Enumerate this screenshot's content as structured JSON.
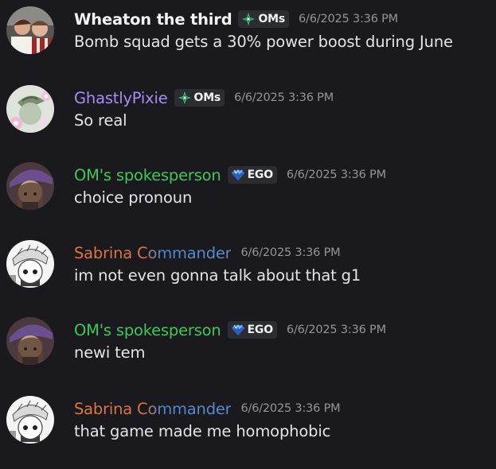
{
  "messages": [
    {
      "username": "Wheaton the third",
      "username_color": "#f3f3f5",
      "tag": "OMs",
      "tag_icon": "green-diamond-sparkle-icon",
      "timestamp": "6/6/2025 3:36 PM",
      "content": "Bomb squad gets a 30% power boost during June",
      "avatar": "photo-avatar"
    },
    {
      "username": "GhastlyPixie",
      "username_color": "#a98cf2",
      "tag": "OMs",
      "tag_icon": "green-diamond-sparkle-icon",
      "timestamp": "6/6/2025 3:36 PM",
      "content": "So real",
      "avatar": "flower-avatar"
    },
    {
      "username": "OM's spokesperson",
      "username_color": "#3fc75a",
      "tag": "EGO",
      "tag_icon": "blue-gem-icon",
      "timestamp": "6/6/2025 3:36 PM",
      "content": "choice pronoun",
      "avatar": "witch-hat-avatar"
    },
    {
      "username": "Sabrina Commander",
      "username_color": "gradient-orange-blue",
      "tag": "",
      "tag_icon": "",
      "timestamp": "6/6/2025 3:36 PM",
      "content": "im not even gonna talk about that g1",
      "avatar": "sketch-character-avatar"
    },
    {
      "username": "OM's spokesperson",
      "username_color": "#3fc75a",
      "tag": "EGO",
      "tag_icon": "blue-gem-icon",
      "timestamp": "6/6/2025 3:36 PM",
      "content": "newi tem",
      "avatar": "witch-hat-avatar"
    },
    {
      "username": "Sabrina Commander",
      "username_color": "gradient-orange-blue",
      "tag": "",
      "tag_icon": "",
      "timestamp": "6/6/2025 3:36 PM",
      "content": "that game made me homophobic",
      "avatar": "sketch-character-avatar"
    }
  ]
}
